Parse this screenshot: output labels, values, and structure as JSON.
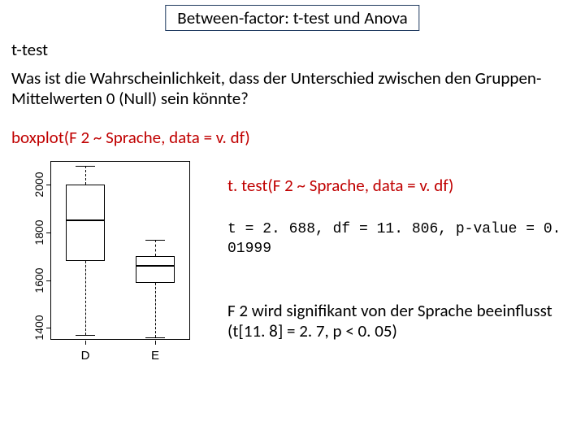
{
  "title": "Between-factor: t-test und Anova",
  "heading": "t-test",
  "question": "Was ist die Wahrscheinlichkeit, dass der Unterschied zwischen den Gruppen-Mittelwerten 0 (Null) sein könnte?",
  "code1": "boxplot(F 2 ~ Sprache, data = v. df)",
  "code2": "t. test(F 2 ~ Sprache, data = v. df)",
  "output": "t = 2. 688, df = 11. 806, p-value = 0. 01999",
  "conclusion": "F 2 wird signifikant von der Sprache beeinflusst (t[11. 8] = 2. 7, p < 0. 05)",
  "chart_data": {
    "type": "boxplot",
    "title": "",
    "xlabel": "",
    "ylabel": "",
    "ylim": [
      1350,
      2100
    ],
    "yticks": [
      1400,
      1600,
      1800,
      2000
    ],
    "categories": [
      "D",
      "E"
    ],
    "series": [
      {
        "name": "D",
        "min": 1370,
        "q1": 1680,
        "median": 1850,
        "q3": 2000,
        "max": 2080
      },
      {
        "name": "E",
        "min": 1360,
        "q1": 1590,
        "median": 1660,
        "q3": 1700,
        "max": 1770
      }
    ]
  }
}
